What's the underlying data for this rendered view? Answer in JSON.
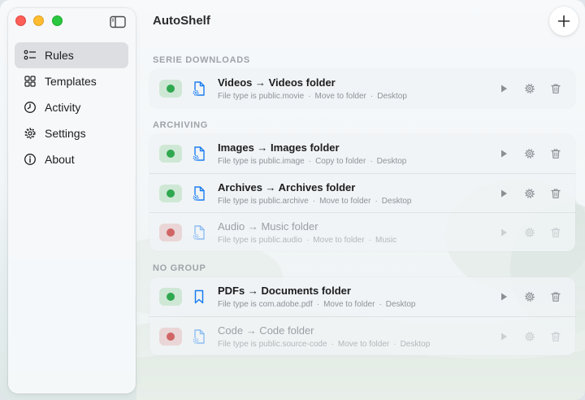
{
  "app": {
    "title": "AutoShelf"
  },
  "sidebar": {
    "items": [
      {
        "label": "Rules",
        "icon": "rules-list-icon",
        "active": true
      },
      {
        "label": "Templates",
        "icon": "grid-icon",
        "active": false
      },
      {
        "label": "Activity",
        "icon": "clock-icon",
        "active": false
      },
      {
        "label": "Settings",
        "icon": "gear-icon",
        "active": false
      },
      {
        "label": "About",
        "icon": "info-icon",
        "active": false
      }
    ]
  },
  "sections": [
    {
      "header": "SERIE DOWNLOADS",
      "rules": [
        {
          "title": "Videos → Videos folder",
          "condition": "File type is public.movie",
          "action": "Move to folder",
          "destination": "Desktop",
          "enabled": true,
          "icon": "document-gear-icon"
        }
      ]
    },
    {
      "header": "ARCHIVING",
      "rules": [
        {
          "title": "Images → Images folder",
          "condition": "File type is public.image",
          "action": "Copy to folder",
          "destination": "Desktop",
          "enabled": true,
          "icon": "document-gear-icon"
        },
        {
          "title": "Archives → Archives folder",
          "condition": "File type is public.archive",
          "action": "Move to folder",
          "destination": "Desktop",
          "enabled": true,
          "icon": "document-gear-icon"
        },
        {
          "title": "Audio → Music folder",
          "condition": "File type is public.audio",
          "action": "Move to folder",
          "destination": "Music",
          "enabled": false,
          "icon": "document-gear-icon"
        }
      ]
    },
    {
      "header": "NO GROUP",
      "rules": [
        {
          "title": "PDFs → Documents folder",
          "condition": "File type is com.adobe.pdf",
          "action": "Move to folder",
          "destination": "Desktop",
          "enabled": true,
          "icon": "bookmark-icon"
        },
        {
          "title": "Code → Code folder",
          "condition": "File type is public.source-code",
          "action": "Move to folder",
          "destination": "Desktop",
          "enabled": false,
          "icon": "document-gear-icon"
        }
      ]
    }
  ],
  "colors": {
    "accent": "#1a7cf0",
    "enabled": "#2fa84f",
    "disabled": "#d06565",
    "close": "#fe5f57",
    "minimize": "#febc2e",
    "maximize": "#28c840"
  }
}
